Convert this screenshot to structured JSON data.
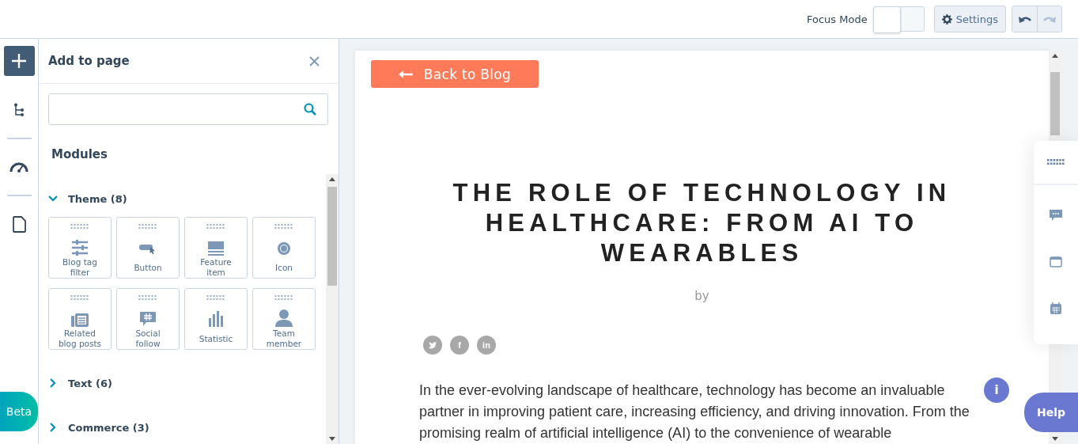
{
  "topbar": {
    "focus_mode": {
      "label": "Focus Mode",
      "on": false
    },
    "settings": "Settings"
  },
  "rail": {
    "items": [
      {
        "kind": "add",
        "selected": true
      },
      {
        "kind": "tree",
        "selected": false
      },
      {
        "kind": "gauge",
        "selected": false
      },
      {
        "kind": "page",
        "selected": false
      }
    ],
    "beta": "Beta"
  },
  "panel": {
    "title": "Add to page",
    "section": "Modules",
    "groups": [
      {
        "label": "Theme (8)",
        "expanded": true,
        "modules": [
          {
            "label": "Blog tag filter",
            "kind": "sliders"
          },
          {
            "label": "Button",
            "kind": "button"
          },
          {
            "label": "Feature item",
            "kind": "feature"
          },
          {
            "label": "Icon",
            "kind": "icon"
          },
          {
            "label": "Related blog posts",
            "kind": "posts"
          },
          {
            "label": "Social follow",
            "kind": "social"
          },
          {
            "label": "Statistic",
            "kind": "stat"
          },
          {
            "label": "Team member",
            "kind": "person"
          }
        ]
      },
      {
        "label": "Text (6)",
        "expanded": false
      },
      {
        "label": "Commerce (3)",
        "expanded": false
      }
    ]
  },
  "preview": {
    "back_button": "Back to Blog",
    "title": "THE ROLE OF TECHNOLOGY IN HEALTHCARE: FROM AI TO WEARABLES",
    "byline": "by",
    "share": [
      {
        "kind": "twitter"
      },
      {
        "kind": "facebook",
        "label": "f"
      },
      {
        "kind": "linkedin",
        "label": "in"
      }
    ],
    "paragraph": "In the ever-evolving landscape of healthcare, technology has become an invaluable partner in improving patient care, increasing efficiency, and driving innovation. From the promising realm of artificial intelligence (AI) to the convenience of wearable"
  },
  "side_toolbar": [
    {
      "kind": "drag"
    },
    {
      "kind": "comment"
    },
    {
      "kind": "window"
    },
    {
      "kind": "calendar"
    }
  ],
  "info_badge": "i",
  "help": "Help"
}
